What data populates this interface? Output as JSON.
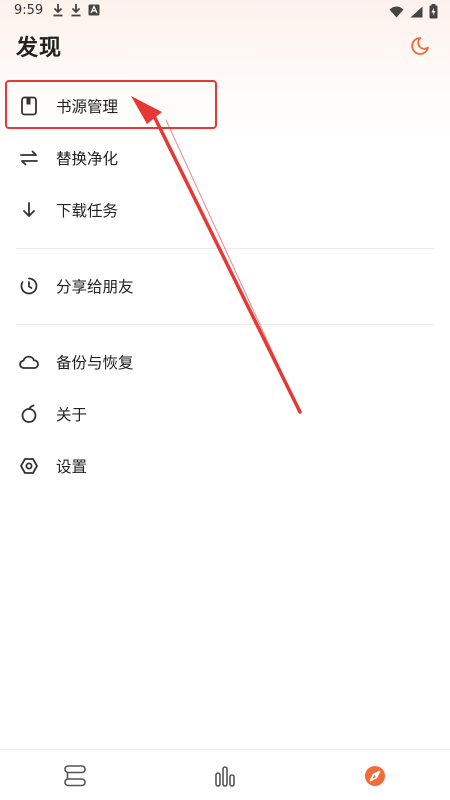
{
  "status_bar": {
    "time": "9:59",
    "left_icons": [
      "download-icon",
      "download-icon",
      "app-icon"
    ],
    "right_icons": [
      "wifi-icon",
      "signal-icon",
      "battery-charging-icon"
    ]
  },
  "header": {
    "title": "发现",
    "theme_icon": "moon-icon"
  },
  "menu": {
    "items": [
      {
        "label": "书源管理",
        "icon": "book-source-icon"
      },
      {
        "label": "替换净化",
        "icon": "swap-icon"
      },
      {
        "label": "下载任务",
        "icon": "download-arrow-icon"
      },
      {
        "label": "分享给朋友",
        "icon": "share-timer-icon"
      },
      {
        "label": "备份与恢复",
        "icon": "cloud-icon"
      },
      {
        "label": "关于",
        "icon": "about-icon"
      },
      {
        "label": "设置",
        "icon": "settings-icon"
      }
    ]
  },
  "bottom_nav": {
    "items": [
      {
        "icon": "bookshelf-icon",
        "active": false
      },
      {
        "icon": "explore-bars-icon",
        "active": false
      },
      {
        "icon": "compass-icon",
        "active": true
      }
    ]
  },
  "colors": {
    "accent": "#f26b3a",
    "annotation": "#e53935",
    "text": "#222222",
    "icon": "#333333"
  }
}
